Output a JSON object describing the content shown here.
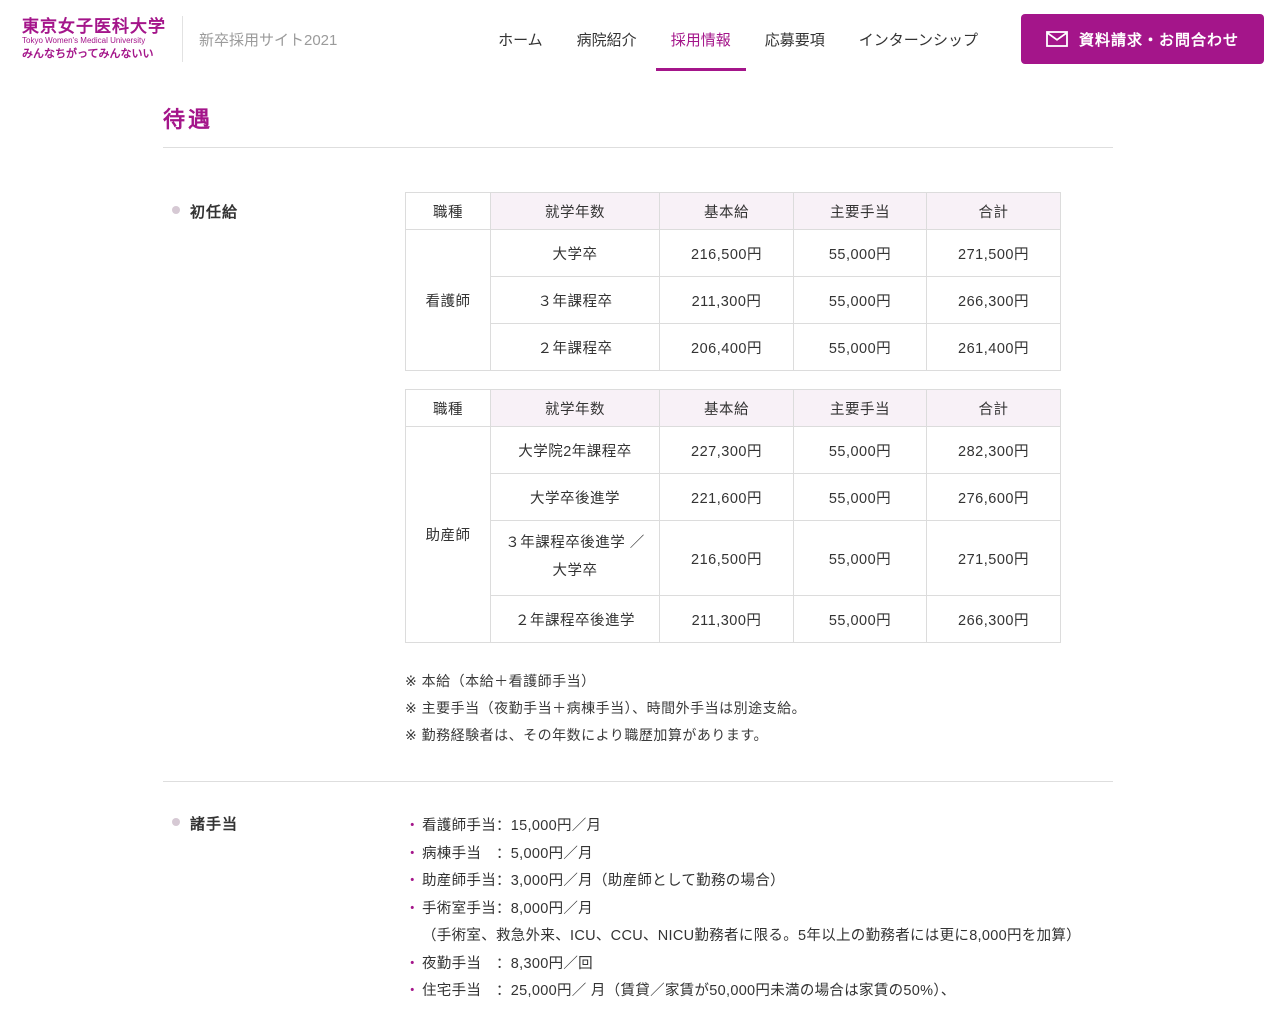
{
  "colors": {
    "accent": "#A4158A",
    "table_header_bg": "#F8F1F7",
    "border": "#DCDCDC",
    "text": "#333333"
  },
  "header": {
    "logo": {
      "title": "東京女子医科大学",
      "subtitle": "Tokyo Women's Medical University",
      "tagline": "みんなちがってみんないい"
    },
    "site_name": "新卒採用サイト2021",
    "nav": [
      {
        "label": "ホーム",
        "active": false
      },
      {
        "label": "病院紹介",
        "active": false
      },
      {
        "label": "採用情報",
        "active": true
      },
      {
        "label": "応募要項",
        "active": false
      },
      {
        "label": "インターンシップ",
        "active": false
      }
    ],
    "contact_button_label": "資料請求・お問合わせ"
  },
  "page": {
    "title": "待遇"
  },
  "salary": {
    "label": "初任給",
    "nurse": {
      "headers": [
        "職種",
        "就学年数",
        "基本給",
        "主要手当",
        "合計"
      ],
      "job": "看護師",
      "rows": [
        {
          "edu": "大学卒",
          "base": "216,500円",
          "main": "55,000円",
          "total": "271,500円"
        },
        {
          "edu": "３年課程卒",
          "base": "211,300円",
          "main": "55,000円",
          "total": "266,300円"
        },
        {
          "edu": "２年課程卒",
          "base": "206,400円",
          "main": "55,000円",
          "total": "261,400円"
        }
      ]
    },
    "midwife": {
      "headers": [
        "職種",
        "就学年数",
        "基本給",
        "主要手当",
        "合計"
      ],
      "job": "助産師",
      "rows": [
        {
          "edu": "大学院2年課程卒",
          "base": "227,300円",
          "main": "55,000円",
          "total": "282,300円"
        },
        {
          "edu": "大学卒後進学",
          "base": "221,600円",
          "main": "55,000円",
          "total": "276,600円"
        },
        {
          "edu": "３年課程卒後進学 ／",
          "edu2": "大学卒",
          "base": "216,500円",
          "main": "55,000円",
          "total": "271,500円"
        },
        {
          "edu": "２年課程卒後進学",
          "base": "211,300円",
          "main": "55,000円",
          "total": "266,300円"
        }
      ]
    },
    "notes": [
      "※ 本給（本給＋看護師手当）",
      "※ 主要手当（夜勤手当＋病棟手当）、時間外手当は別途支給。",
      "※ 勤務経験者は、その年数により職歴加算があります。"
    ]
  },
  "allowances": {
    "label": "諸手当",
    "bullet_glyph": "・",
    "items": [
      {
        "bullet": true,
        "text": "看護師手当：15,000円／月"
      },
      {
        "bullet": true,
        "text": "病棟手当　：5,000円／月"
      },
      {
        "bullet": true,
        "text": "助産師手当：3,000円／月（助産師として勤務の場合）"
      },
      {
        "bullet": true,
        "text": "手術室手当：8,000円／月"
      },
      {
        "bullet": false,
        "text": "（手術室、救急外来、ICU、CCU、NICU勤務者に限る。5年以上の勤務者には更に8,000円を加算）"
      },
      {
        "bullet": true,
        "text": "夜勤手当　：8,300円／回"
      },
      {
        "bullet": true,
        "text": "住宅手当　：25,000円／ 月（賃貸／家賃が50,000円未満の場合は家賃の50%）、"
      }
    ]
  }
}
